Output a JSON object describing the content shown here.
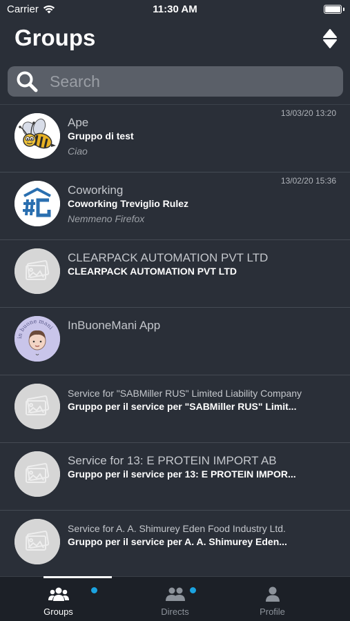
{
  "status_bar": {
    "carrier": "Carrier",
    "time": "11:30 AM"
  },
  "header": {
    "title": "Groups",
    "sort_icon": "sort-icon"
  },
  "search": {
    "placeholder": "Search",
    "value": ""
  },
  "groups": [
    {
      "title": "Ape",
      "subtitle": "Gruppo di test",
      "message": "Ciao",
      "time": "13/03/20 13:20",
      "avatar": "bee-avatar"
    },
    {
      "title": "Coworking",
      "subtitle": "Coworking Treviglio Rulez",
      "message": "Nemmeno Firefox",
      "time": "13/02/20 15:36",
      "avatar": "hashtag-logo-avatar"
    },
    {
      "title": "CLEARPACK AUTOMATION PVT LTD",
      "subtitle": "CLEARPACK AUTOMATION PVT LTD",
      "message": "",
      "time": "",
      "avatar": "image-placeholder-avatar"
    },
    {
      "title": "InBuoneMani App",
      "subtitle": "",
      "message": "",
      "time": "",
      "avatar": "in-buone-mani-avatar",
      "avatar_text": "in buone mani"
    },
    {
      "title": "Service for \"SABMiller RUS\" Limited Liability Company",
      "subtitle": "Gruppo per il service per \"SABMiller RUS\" Limit...",
      "message": "",
      "time": "",
      "avatar": "image-placeholder-avatar"
    },
    {
      "title": "Service for 13: E PROTEIN IMPORT AB",
      "subtitle": "Gruppo per il service per 13: E PROTEIN IMPOR...",
      "message": "",
      "time": "",
      "avatar": "image-placeholder-avatar"
    },
    {
      "title": "Service for A. A. Shimurey Eden Food Industry Ltd.",
      "subtitle": "Gruppo per il service per A. A. Shimurey Eden...",
      "message": "",
      "time": "",
      "avatar": "image-placeholder-avatar"
    }
  ],
  "tabs": [
    {
      "label": "Groups",
      "icon": "groups-icon",
      "active": true,
      "badge": true
    },
    {
      "label": "Directs",
      "icon": "directs-icon",
      "active": false,
      "badge": true
    },
    {
      "label": "Profile",
      "icon": "profile-icon",
      "active": false,
      "badge": false
    }
  ],
  "colors": {
    "background": "#2a2f38",
    "tab_bar": "#1c2027",
    "badge": "#1ba3e0",
    "search_bg": "#5a5f68"
  }
}
